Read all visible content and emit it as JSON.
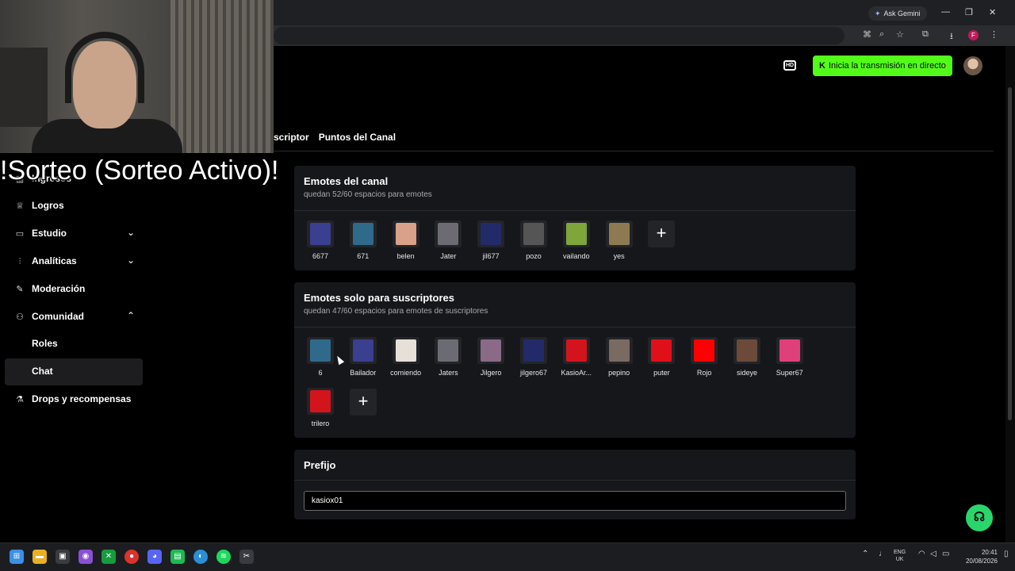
{
  "browser": {
    "gemini_label": "Ask Gemini",
    "profile_initial": "F"
  },
  "header": {
    "live_button_label": "Inicia la transmisión en directo",
    "live_icon": "K"
  },
  "tabs": [
    "scriptor",
    "Puntos del Canal"
  ],
  "overlay_text": "!Sorteo (Sorteo Activo)!",
  "sidebar": {
    "items": [
      {
        "label": "Ingresos",
        "icon": "bank-icon"
      },
      {
        "label": "Logros",
        "icon": "trophy-icon"
      },
      {
        "label": "Estudio",
        "icon": "studio-icon"
      },
      {
        "label": "Analíticas",
        "icon": "analytics-icon"
      },
      {
        "label": "Moderación",
        "icon": "wrench-icon"
      },
      {
        "label": "Comunidad",
        "icon": "community-icon"
      },
      {
        "label": "Roles",
        "icon": ""
      },
      {
        "label": "Chat",
        "icon": ""
      },
      {
        "label": "Drops y recompensas",
        "icon": "gift-icon"
      }
    ]
  },
  "channel_emotes": {
    "title": "Emotes del canal",
    "subtitle": "quedan 52/60 espacios para emotes",
    "emotes": [
      {
        "name": "6677",
        "color": "#3a3f8f"
      },
      {
        "name": "671",
        "color": "#2f6a8a"
      },
      {
        "name": "belen",
        "color": "#d9a08a"
      },
      {
        "name": "Jater",
        "color": "#6c6a72"
      },
      {
        "name": "jil677",
        "color": "#232a6a"
      },
      {
        "name": "pozo",
        "color": "#555555"
      },
      {
        "name": "vailando",
        "color": "#7ea63a"
      },
      {
        "name": "yes",
        "color": "#8d7a52"
      }
    ]
  },
  "sub_emotes": {
    "title": "Emotes solo para suscriptores",
    "subtitle": "quedan 47/60 espacios para emotes de suscriptores",
    "emotes": [
      {
        "name": "6",
        "color": "#2f6a8a"
      },
      {
        "name": "Bailador",
        "color": "#3a3f8f"
      },
      {
        "name": "comiendo",
        "color": "#e6e0d8"
      },
      {
        "name": "Jaters",
        "color": "#6c6a72"
      },
      {
        "name": "Jilgero",
        "color": "#8a6a86"
      },
      {
        "name": "jilgero67",
        "color": "#232a6a"
      },
      {
        "name": "KasioAr...",
        "color": "#d4141c"
      },
      {
        "name": "pepino",
        "color": "#7a6b62"
      },
      {
        "name": "puter",
        "color": "#e0101a"
      },
      {
        "name": "Rojo",
        "color": "#ff0000"
      },
      {
        "name": "sideye",
        "color": "#6b4a3a"
      },
      {
        "name": "Super67",
        "color": "#e0407a"
      },
      {
        "name": "trilero",
        "color": "#d4141c"
      }
    ]
  },
  "prefix": {
    "title": "Prefijo",
    "value": "kasiox01"
  },
  "taskbar": {
    "lang_line1": "ENG",
    "lang_line2": "UK",
    "time": "20:41",
    "date": "20/08/2026"
  }
}
